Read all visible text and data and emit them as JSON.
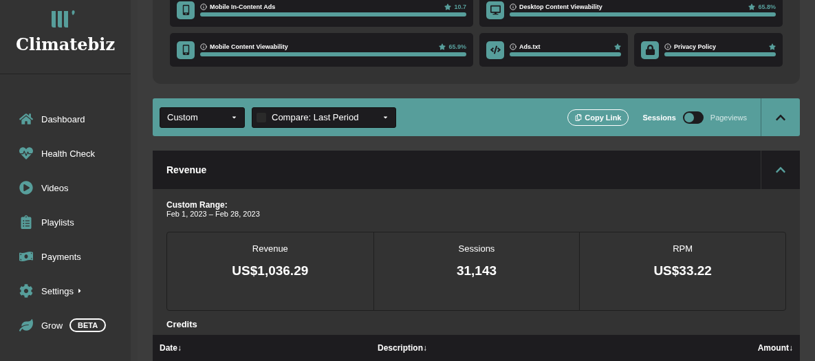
{
  "sidebar": {
    "brand": "Climatebiz",
    "items": [
      {
        "label": "Dashboard",
        "kind": "home"
      },
      {
        "label": "Health Check",
        "kind": "heart"
      },
      {
        "label": "Videos",
        "kind": "play"
      },
      {
        "label": "Playlists",
        "kind": "list"
      },
      {
        "label": "Payments",
        "kind": "money"
      },
      {
        "label": "Settings",
        "kind": "gear",
        "submenu": true
      },
      {
        "label": "Grow",
        "kind": "leaf",
        "badge": "BETA"
      }
    ]
  },
  "health_cards": [
    {
      "title": "Mobile In-Content Ads",
      "value": "10.7",
      "kind": "mobile",
      "wide": true,
      "level": 1
    },
    {
      "title": "Desktop Content Viewability",
      "value": "65.8%",
      "kind": "desktop-eye",
      "wide": true,
      "level": 1
    },
    {
      "title": "Mobile Content Viewability",
      "value": "65.9%",
      "kind": "mobile-eye",
      "wide": true,
      "level": 1
    },
    {
      "title": "Ads.txt",
      "kind": "code",
      "wide": false,
      "level": 1
    },
    {
      "title": "Privacy Policy",
      "kind": "lock",
      "wide": false,
      "level": 1
    }
  ],
  "toolbar": {
    "range": "Custom",
    "compare": "Compare: Last Period",
    "copy": "Copy Link",
    "toggle_left": "Sessions",
    "toggle_right": "Pageviews",
    "toggle_on": false
  },
  "revenue": {
    "title": "Revenue",
    "range_label": "Custom Range:",
    "range": "Feb 1, 2023 – Feb 28, 2023",
    "stats": [
      {
        "label": "Revenue",
        "value": "US$1,036.29"
      },
      {
        "label": "Sessions",
        "value": "31,143"
      },
      {
        "label": "RPM",
        "value": "US$33.22"
      }
    ],
    "credits_title": "Credits",
    "columns": [
      "Date↓",
      "Description↓",
      "Amount↓"
    ]
  }
}
